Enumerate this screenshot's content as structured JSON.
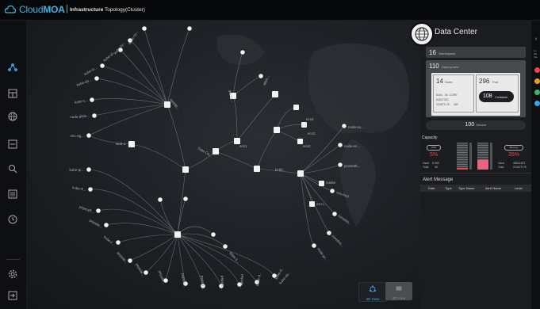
{
  "header": {
    "brand_prefix": "Cloud",
    "brand_suffix": "MOA",
    "separator": "|",
    "title_bold": "Infrastructure",
    "title_rest": " Topology(Cluster)"
  },
  "sidebar": {
    "icons": [
      "topology-icon",
      "dashboard-icon",
      "globe-icon",
      "window-icon",
      "search-icon",
      "list-icon",
      "clock-icon",
      "settings-icon",
      "logout-icon"
    ]
  },
  "topology": {
    "center_label": "Data Ce...",
    "hubs": [
      "wasdp...",
      "web-1",
      "ecs1",
      "docka...",
      "apps...",
      "bl-lbl..",
      "ecs3",
      "ecs2",
      "ecs2",
      "nodes",
      "os-n..."
    ],
    "left_labels": [
      "kube-sy...",
      "kube-sy...",
      "kube-pi...",
      "kube-lo...",
      "kube-do...",
      "kube-c..",
      "istio...",
      "mtc-ag...",
      "node-e...",
      "phpmsli...",
      "kube-pi...",
      "kube-fl...",
      "phpmyff...",
      "pepsile...",
      "kube-f..."
    ],
    "bottom_labels": [
      "pepsile...",
      "pepsile...",
      "pepsile...",
      "pepsile...",
      "pepsile...",
      "pepsile...",
      "pepsile...",
      "kube-d..",
      "kube-d..",
      "kube-do..."
    ],
    "right_labels": [
      "node-ex...",
      "node-ex...",
      "prometh...",
      "ecs-nod..",
      "coredns...",
      "coredns...",
      "node-pr...",
      "apps-1..."
    ]
  },
  "view_toggle": {
    "view_2d": "2D View",
    "view_3d": "3D View"
  },
  "datacenter": {
    "title": "Data Center",
    "namespace_count": "16",
    "namespace_label": "Namespace",
    "deployment_count": "110",
    "deployment_label": "Deployment",
    "node_count": "14",
    "node_label": "Node",
    "pod_count": "296",
    "pod_label": "Pod",
    "container_count": "108",
    "container_label": "Container",
    "cpu_row": [
      "6404",
      "36",
      "CORE"
    ],
    "mem_row": [
      "84017320",
      "",
      ""
    ],
    "mem_row2": [
      "224679.78",
      "",
      "MB"
    ],
    "service_count": "100",
    "service_label": "Service"
  },
  "capacity": {
    "title": "Capacity",
    "cpu_label": "CPU",
    "cpu_percent": "5%",
    "cpu_used_label": "Used",
    "cpu_used": "6,069",
    "cpu_total_label": "Total",
    "cpu_total": "36",
    "memory_label": "Memory",
    "memory_percent": "35%",
    "mem_used_label": "Used",
    "mem_used": "48511452",
    "mem_total_label": "Total",
    "mem_total": "224679.78",
    "cpu_fill": 0.05,
    "mem_fill": 0.35
  },
  "alerts": {
    "title": "Alert Message",
    "columns": [
      "Date",
      "Type",
      "Type Name",
      "Alert Name",
      "Level"
    ]
  },
  "far_right": {
    "lines": [
      "Lo",
      "Ale",
      "Sta"
    ]
  },
  "colors": {
    "accent": "#3fb4e8",
    "danger": "#e84848",
    "container_pill": "#1c1e22"
  }
}
